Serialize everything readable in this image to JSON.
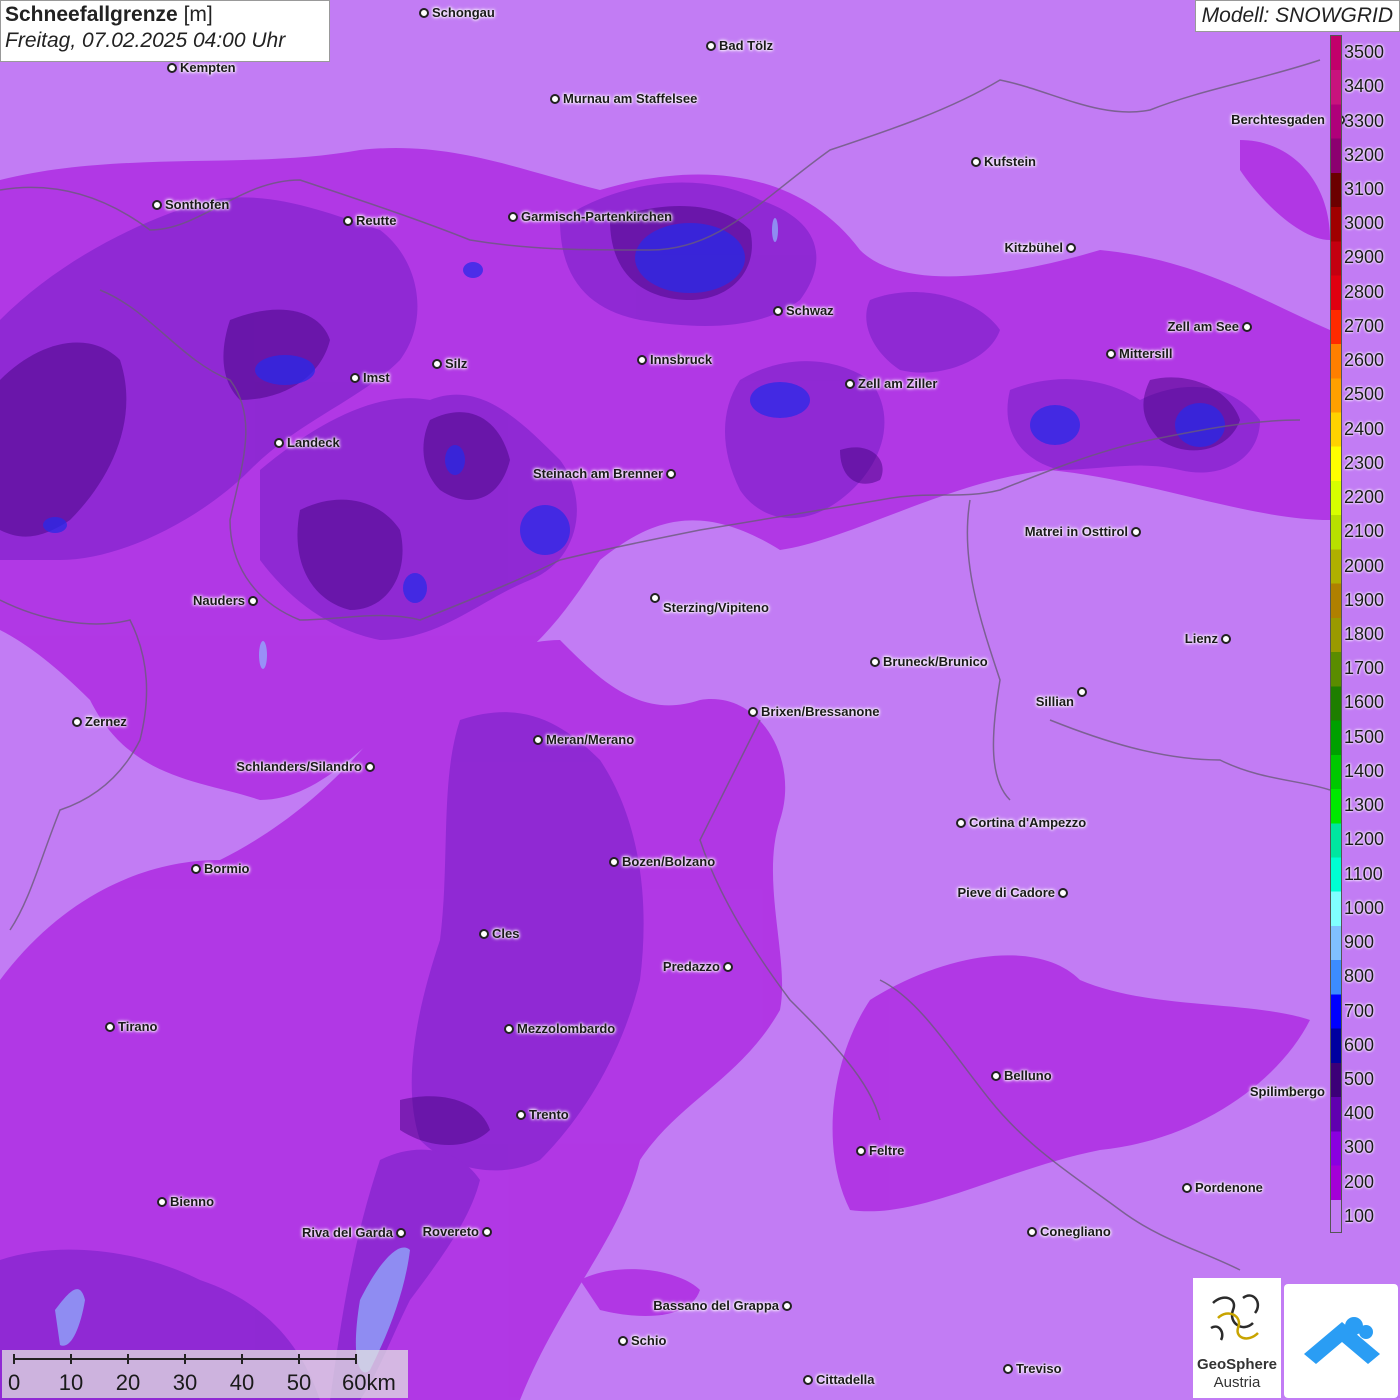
{
  "title": {
    "main": "Schneefallgrenze",
    "unit": "[m]",
    "datetime": "Freitag, 07.02.2025 04:00 Uhr"
  },
  "model": "Modell: SNOWGRID",
  "legend": {
    "levels": [
      "3500",
      "3400",
      "3300",
      "3200",
      "3100",
      "3000",
      "2900",
      "2800",
      "2700",
      "2600",
      "2500",
      "2400",
      "2300",
      "2200",
      "2100",
      "2000",
      "1900",
      "1800",
      "1700",
      "1600",
      "1500",
      "1400",
      "1300",
      "1200",
      "1100",
      "1000",
      "900",
      "800",
      "700",
      "600",
      "500",
      "400",
      "300",
      "200",
      "100"
    ],
    "colors": [
      "#c2006b",
      "#c8137d",
      "#b0007a",
      "#8c0070",
      "#6b0000",
      "#a00000",
      "#c40010",
      "#e00010",
      "#ff2a00",
      "#ff7f00",
      "#ffa000",
      "#ffd200",
      "#ffff00",
      "#d7ff00",
      "#b8e000",
      "#b0b000",
      "#b08000",
      "#9a9a00",
      "#5a8c00",
      "#1e7e00",
      "#00a000",
      "#00c800",
      "#00e800",
      "#00e6a0",
      "#00ffd2",
      "#80ffff",
      "#80c0ff",
      "#3c8cff",
      "#0000ff",
      "#0000a0",
      "#3c0078",
      "#6000b0",
      "#8a00e0",
      "#a400d8",
      "#c27cf4"
    ]
  },
  "scale": {
    "ticks": [
      "0",
      "10",
      "20",
      "30",
      "40",
      "50",
      "60km"
    ]
  },
  "logos": {
    "geosphere_line1": "GeoSphere",
    "geosphere_line2": "Austria"
  },
  "cities": [
    {
      "name": "Schongau"
    },
    {
      "name": "Bad Tölz"
    },
    {
      "name": "Kempten"
    },
    {
      "name": "Murnau am Staffelsee"
    },
    {
      "name": "Berchtesgaden"
    },
    {
      "name": "Kufstein"
    },
    {
      "name": "Sonthofen"
    },
    {
      "name": "Reutte"
    },
    {
      "name": "Garmisch-Partenkirchen"
    },
    {
      "name": "Kitzbühel"
    },
    {
      "name": "Schwaz"
    },
    {
      "name": "Zell am See"
    },
    {
      "name": "Innsbruck"
    },
    {
      "name": "Mittersill"
    },
    {
      "name": "Imst"
    },
    {
      "name": "Silz"
    },
    {
      "name": "Zell am Ziller"
    },
    {
      "name": "Landeck"
    },
    {
      "name": "Steinach am Brenner"
    },
    {
      "name": "Matrei in Osttirol"
    },
    {
      "name": "Nauders"
    },
    {
      "name": "Sterzing/Vipiteno"
    },
    {
      "name": "Lienz"
    },
    {
      "name": "Bruneck/Brunico"
    },
    {
      "name": "Sillian"
    },
    {
      "name": "Zernez"
    },
    {
      "name": "Brixen/Bressanone"
    },
    {
      "name": "Meran/Merano"
    },
    {
      "name": "Schlanders/Silandro"
    },
    {
      "name": "Cortina d'Ampezzo"
    },
    {
      "name": "Bozen/Bolzano"
    },
    {
      "name": "Bormio"
    },
    {
      "name": "Pieve di Cadore"
    },
    {
      "name": "Cles"
    },
    {
      "name": "Predazzo"
    },
    {
      "name": "Tirano"
    },
    {
      "name": "Mezzolombardo"
    },
    {
      "name": "Belluno"
    },
    {
      "name": "Spilimbergo"
    },
    {
      "name": "Trento"
    },
    {
      "name": "Feltre"
    },
    {
      "name": "Pordenone"
    },
    {
      "name": "Bienno"
    },
    {
      "name": "Riva del Garda"
    },
    {
      "name": "Rovereto"
    },
    {
      "name": "Conegliano"
    },
    {
      "name": "Bassano del Grappa"
    },
    {
      "name": "Schio"
    },
    {
      "name": "Treviso"
    },
    {
      "name": "Cittadella"
    }
  ]
}
